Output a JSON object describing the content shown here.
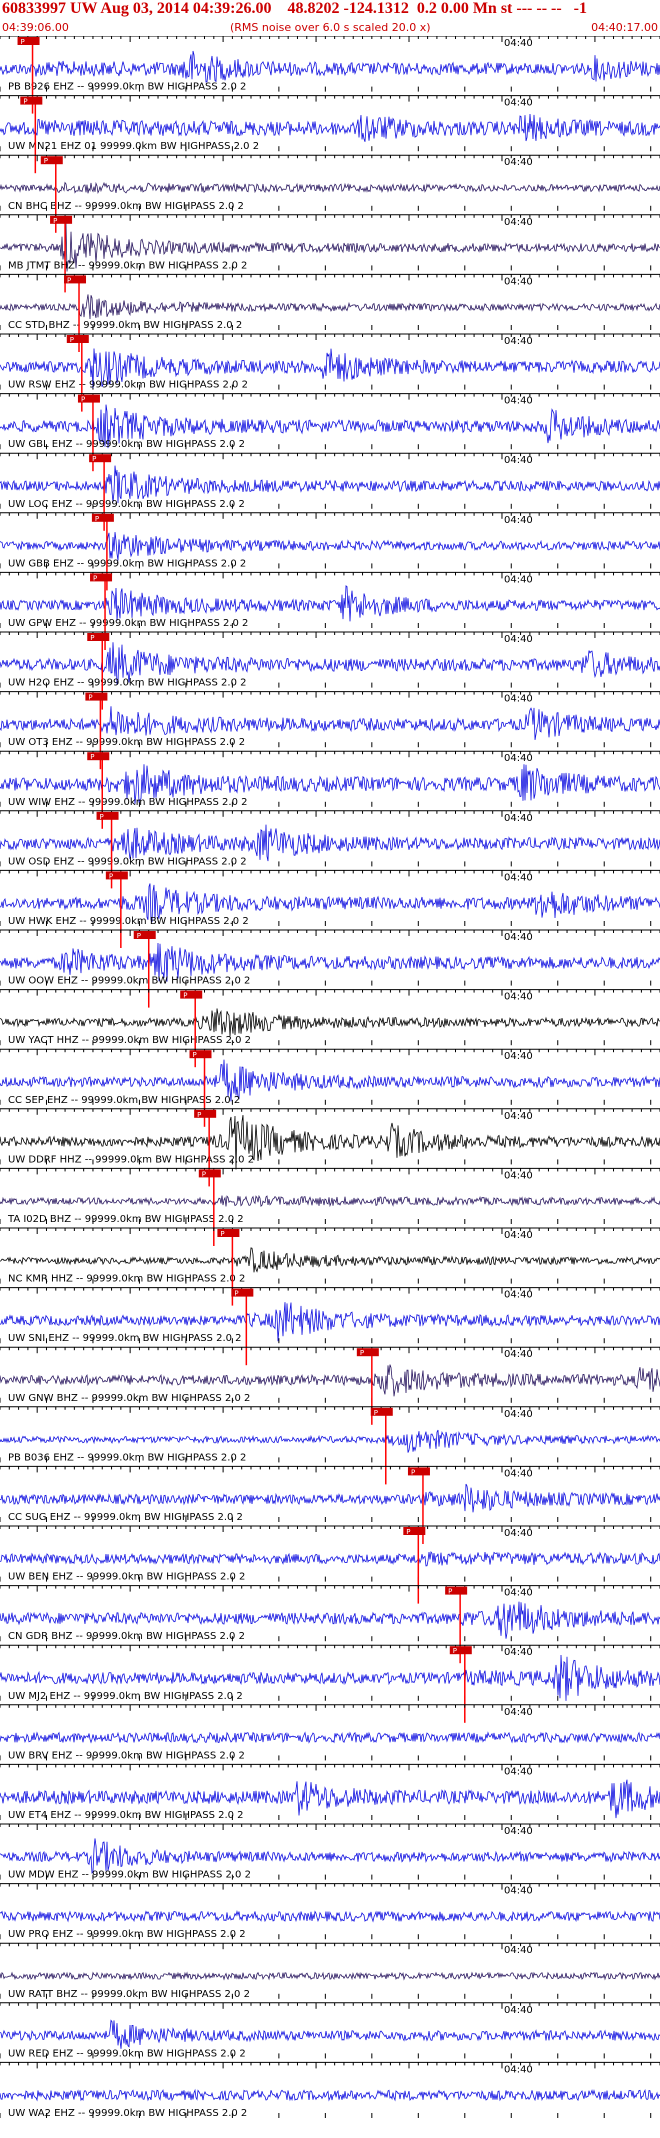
{
  "header": {
    "title": "60833997 UW Aug 03, 2014 04:39:26.00    48.8202 -124.1312  0.2 0.00 Mn st --- -- --   -1",
    "start_time": "04:39:06.00",
    "end_time": "04:40:17.00",
    "rms_note": "(RMS noise over 6.0 s scaled 20.0 x)"
  },
  "colors": {
    "trace_default": "#1010e0",
    "trace_dark": "#2a1860",
    "trace_black": "#000000",
    "pick": "#ff0000",
    "pick_label_bg": "#cc0000",
    "axis": "#000000",
    "text": "#000000"
  },
  "chart_data": {
    "type": "seismogram",
    "x_start": "04:39:06.00",
    "x_end": "04:40:17.00",
    "minute_label": "04:40",
    "minute_mark_time": "04:40:00",
    "pick_label": "P",
    "traces": [
      {
        "label": "PB B926 EHZ -- 99999.0km BW  HIGHPASS  2.0  2",
        "pick": "04:39:09.5",
        "color": "trace_default",
        "amp": 0.35,
        "bursts": [
          [
            "04:39:26",
            0.9
          ],
          [
            "04:40:10",
            0.5
          ]
        ]
      },
      {
        "label": "UW MN21 EHZ 01 99999.0km BW  HIGHPASS  2.0  2",
        "pick": "04:39:09.8",
        "color": "trace_default",
        "amp": 0.4,
        "bursts": [
          [
            "04:39:45",
            0.6
          ],
          [
            "04:40:02",
            0.6
          ]
        ]
      },
      {
        "label": "CN BHC BHZ -- 99999.0km BW  HIGHPASS  2.0  2",
        "pick": "04:39:12.0",
        "color": "trace_dark",
        "amp": 0.2,
        "bursts": []
      },
      {
        "label": "MB JTMT BHZ -- 99999.0km BW  HIGHPASS  2.0  2",
        "pick": "04:39:13.0",
        "color": "trace_dark",
        "amp": 0.25,
        "bursts": [
          [
            "04:39:13",
            1.2
          ]
        ]
      },
      {
        "label": "CC STD BHZ -- 99999.0km BW  HIGHPASS  2.0  2",
        "pick": "04:39:14.5",
        "color": "trace_dark",
        "amp": 0.2,
        "bursts": [
          [
            "04:39:15",
            0.5
          ]
        ]
      },
      {
        "label": "UW RSW EHZ -- 99999.0km BW  HIGHPASS  2.0  2",
        "pick": "04:39:14.8",
        "color": "trace_default",
        "amp": 0.35,
        "bursts": [
          [
            "04:39:16",
            1.0
          ],
          [
            "04:39:41",
            0.9
          ]
        ]
      },
      {
        "label": "UW GBL EHZ -- 99999.0km BW  HIGHPASS  2.0  2",
        "pick": "04:39:16.0",
        "color": "trace_default",
        "amp": 0.35,
        "bursts": [
          [
            "04:39:17",
            1.0
          ],
          [
            "04:40:05",
            0.8
          ]
        ]
      },
      {
        "label": "UW LOC EHZ -- 99999.0km BW  HIGHPASS  2.0  2",
        "pick": "04:39:17.2",
        "color": "trace_default",
        "amp": 0.3,
        "bursts": [
          [
            "04:39:18",
            0.9
          ]
        ]
      },
      {
        "label": "UW GBB EHZ -- 99999.0km BW  HIGHPASS  2.0  2",
        "pick": "04:39:17.5",
        "color": "trace_default",
        "amp": 0.25,
        "bursts": [
          [
            "04:39:18",
            0.7
          ]
        ]
      },
      {
        "label": "UW GPW EHZ -- 99999.0km BW  HIGHPASS  2.0  2",
        "pick": "04:39:17.3",
        "color": "trace_default",
        "amp": 0.3,
        "bursts": [
          [
            "04:39:18",
            0.8
          ],
          [
            "04:39:43",
            0.9
          ]
        ]
      },
      {
        "label": "UW H2O EHZ -- 99999.0km BW  HIGHPASS  2.0  2",
        "pick": "04:39:17.0",
        "color": "trace_default",
        "amp": 0.35,
        "bursts": [
          [
            "04:39:18",
            1.0
          ],
          [
            "04:40:09",
            0.7
          ]
        ]
      },
      {
        "label": "UW OT3 EHZ -- 99999.0km BW  HIGHPASS  2.0  2",
        "pick": "04:39:16.8",
        "color": "trace_default",
        "amp": 0.35,
        "bursts": [
          [
            "04:39:18",
            0.7
          ],
          [
            "04:40:03",
            0.8
          ]
        ]
      },
      {
        "label": "UW WIW EHZ -- 99999.0km BW  HIGHPASS  2.0  2",
        "pick": "04:39:17.0",
        "color": "trace_default",
        "amp": 0.4,
        "bursts": [
          [
            "04:39:20",
            1.0
          ],
          [
            "04:40:02",
            1.0
          ]
        ]
      },
      {
        "label": "UW OSD EHZ -- 99999.0km BW  HIGHPASS  2.0  2",
        "pick": "04:39:18.0",
        "color": "trace_default",
        "amp": 0.35,
        "bursts": [
          [
            "04:39:19",
            0.8
          ],
          [
            "04:39:34",
            0.9
          ]
        ]
      },
      {
        "label": "UW HWK EHZ -- 99999.0km BW  HIGHPASS  2.0  2",
        "pick": "04:39:19.0",
        "color": "trace_default",
        "amp": 0.35,
        "bursts": [
          [
            "04:39:22",
            0.8
          ],
          [
            "04:40:04",
            0.9
          ]
        ]
      },
      {
        "label": "UW OOW EHZ -- 99999.0km BW  HIGHPASS  2.0  2",
        "pick": "04:39:22.0",
        "color": "trace_default",
        "amp": 0.35,
        "bursts": [
          [
            "04:39:13",
            0.7
          ],
          [
            "04:39:23",
            0.9
          ]
        ]
      },
      {
        "label": "UW YACT HHZ -- 99999.0km BW  HIGHPASS  2.0  2",
        "pick": "04:39:27.0",
        "color": "trace_black",
        "amp": 0.25,
        "bursts": [
          [
            "04:39:29",
            0.8
          ]
        ]
      },
      {
        "label": "CC SEP EHZ -- 99999.0km BW  HIGHPASS  2.0  2",
        "pick": "04:39:28.0",
        "color": "trace_default",
        "amp": 0.3,
        "bursts": [
          [
            "04:39:30",
            1.0
          ]
        ]
      },
      {
        "label": "UW DDRF HHZ -- 99999.0km BW  HIGHPASS  2.0  2",
        "pick": "04:39:28.5",
        "color": "trace_black",
        "amp": 0.3,
        "bursts": [
          [
            "04:39:31",
            1.6
          ],
          [
            "04:39:48",
            0.8
          ]
        ]
      },
      {
        "label": "TA I02D BHZ -- 99999.0km BW  HIGHPASS  2.0  2",
        "pick": "04:39:29.0",
        "color": "trace_dark",
        "amp": 0.2,
        "bursts": []
      },
      {
        "label": "NC KMR HHZ -- 99999.0km BW  HIGHPASS  2.0  2",
        "pick": "04:39:31.0",
        "color": "trace_black",
        "amp": 0.2,
        "bursts": [
          [
            "04:39:33",
            0.5
          ]
        ]
      },
      {
        "label": "UW SNI EHZ -- 99999.0km BW  HIGHPASS  2.0  2",
        "pick": "04:39:32.5",
        "color": "trace_default",
        "amp": 0.3,
        "bursts": [
          [
            "04:39:36",
            1.0
          ]
        ]
      },
      {
        "label": "UW GNW BHZ -- 99999.0km BW  HIGHPASS  2.0  2",
        "pick": "04:39:46.0",
        "color": "trace_dark",
        "amp": 0.3,
        "bursts": [
          [
            "04:39:47",
            0.8
          ],
          [
            "04:40:15",
            0.7
          ]
        ]
      },
      {
        "label": "PB B036 EHZ -- 99999.0km BW  HIGHPASS  2.0  2",
        "pick": "04:39:47.5",
        "color": "trace_default",
        "amp": 0.2,
        "bursts": [
          [
            "04:39:50",
            0.6
          ]
        ]
      },
      {
        "label": "CC SUG EHZ -- 99999.0km BW  HIGHPASS  2.0  2",
        "pick": "04:39:51.5",
        "color": "trace_default",
        "amp": 0.3,
        "bursts": [
          [
            "04:39:56",
            0.6
          ]
        ]
      },
      {
        "label": "UW BEN EHZ -- 99999.0km BW  HIGHPASS  2.0  2",
        "pick": "04:39:51.0",
        "color": "trace_default",
        "amp": 0.3,
        "bursts": []
      },
      {
        "label": "CN GDR BHZ -- 99999.0km BW  HIGHPASS  2.0  2",
        "pick": "04:39:55.5",
        "color": "trace_default",
        "amp": 0.35,
        "bursts": [
          [
            "04:40:00",
            1.1
          ]
        ]
      },
      {
        "label": "UW MJ2 EHZ -- 99999.0km BW  HIGHPASS  2.0  2",
        "pick": "04:39:56.0",
        "color": "trace_default",
        "amp": 0.35,
        "bursts": [
          [
            "04:40:06",
            1.2
          ]
        ]
      },
      {
        "label": "UW BRV EHZ -- 99999.0km BW  HIGHPASS  2.0  2",
        "pick": null,
        "color": "trace_default",
        "amp": 0.3,
        "bursts": []
      },
      {
        "label": "UW ET4 EHZ -- 99999.0km BW  HIGHPASS  2.0  2",
        "pick": null,
        "color": "trace_default",
        "amp": 0.4,
        "bursts": [
          [
            "04:39:38",
            0.8
          ],
          [
            "04:40:12",
            1.0
          ]
        ]
      },
      {
        "label": "UW MDW EHZ -- 99999.0km BW  HIGHPASS  2.0  2",
        "pick": null,
        "color": "trace_default",
        "amp": 0.3,
        "bursts": [
          [
            "04:39:16",
            0.9
          ]
        ]
      },
      {
        "label": "UW PRO EHZ -- 99999.0km BW  HIGHPASS  2.0  2",
        "pick": null,
        "color": "trace_default",
        "amp": 0.3,
        "bursts": []
      },
      {
        "label": "UW RATT BHZ -- 99999.0km BW  HIGHPASS  2.0  2",
        "pick": null,
        "color": "trace_dark",
        "amp": 0.2,
        "bursts": []
      },
      {
        "label": "UW RED EHZ -- 99999.0km BW  HIGHPASS  2.0  2",
        "pick": null,
        "color": "trace_default",
        "amp": 0.3,
        "bursts": [
          [
            "04:39:18",
            0.7
          ]
        ]
      },
      {
        "label": "UW WA2 EHZ -- 99999.0km BW  HIGHPASS  2.0  2",
        "pick": null,
        "color": "trace_default",
        "amp": 0.3,
        "bursts": []
      }
    ]
  }
}
